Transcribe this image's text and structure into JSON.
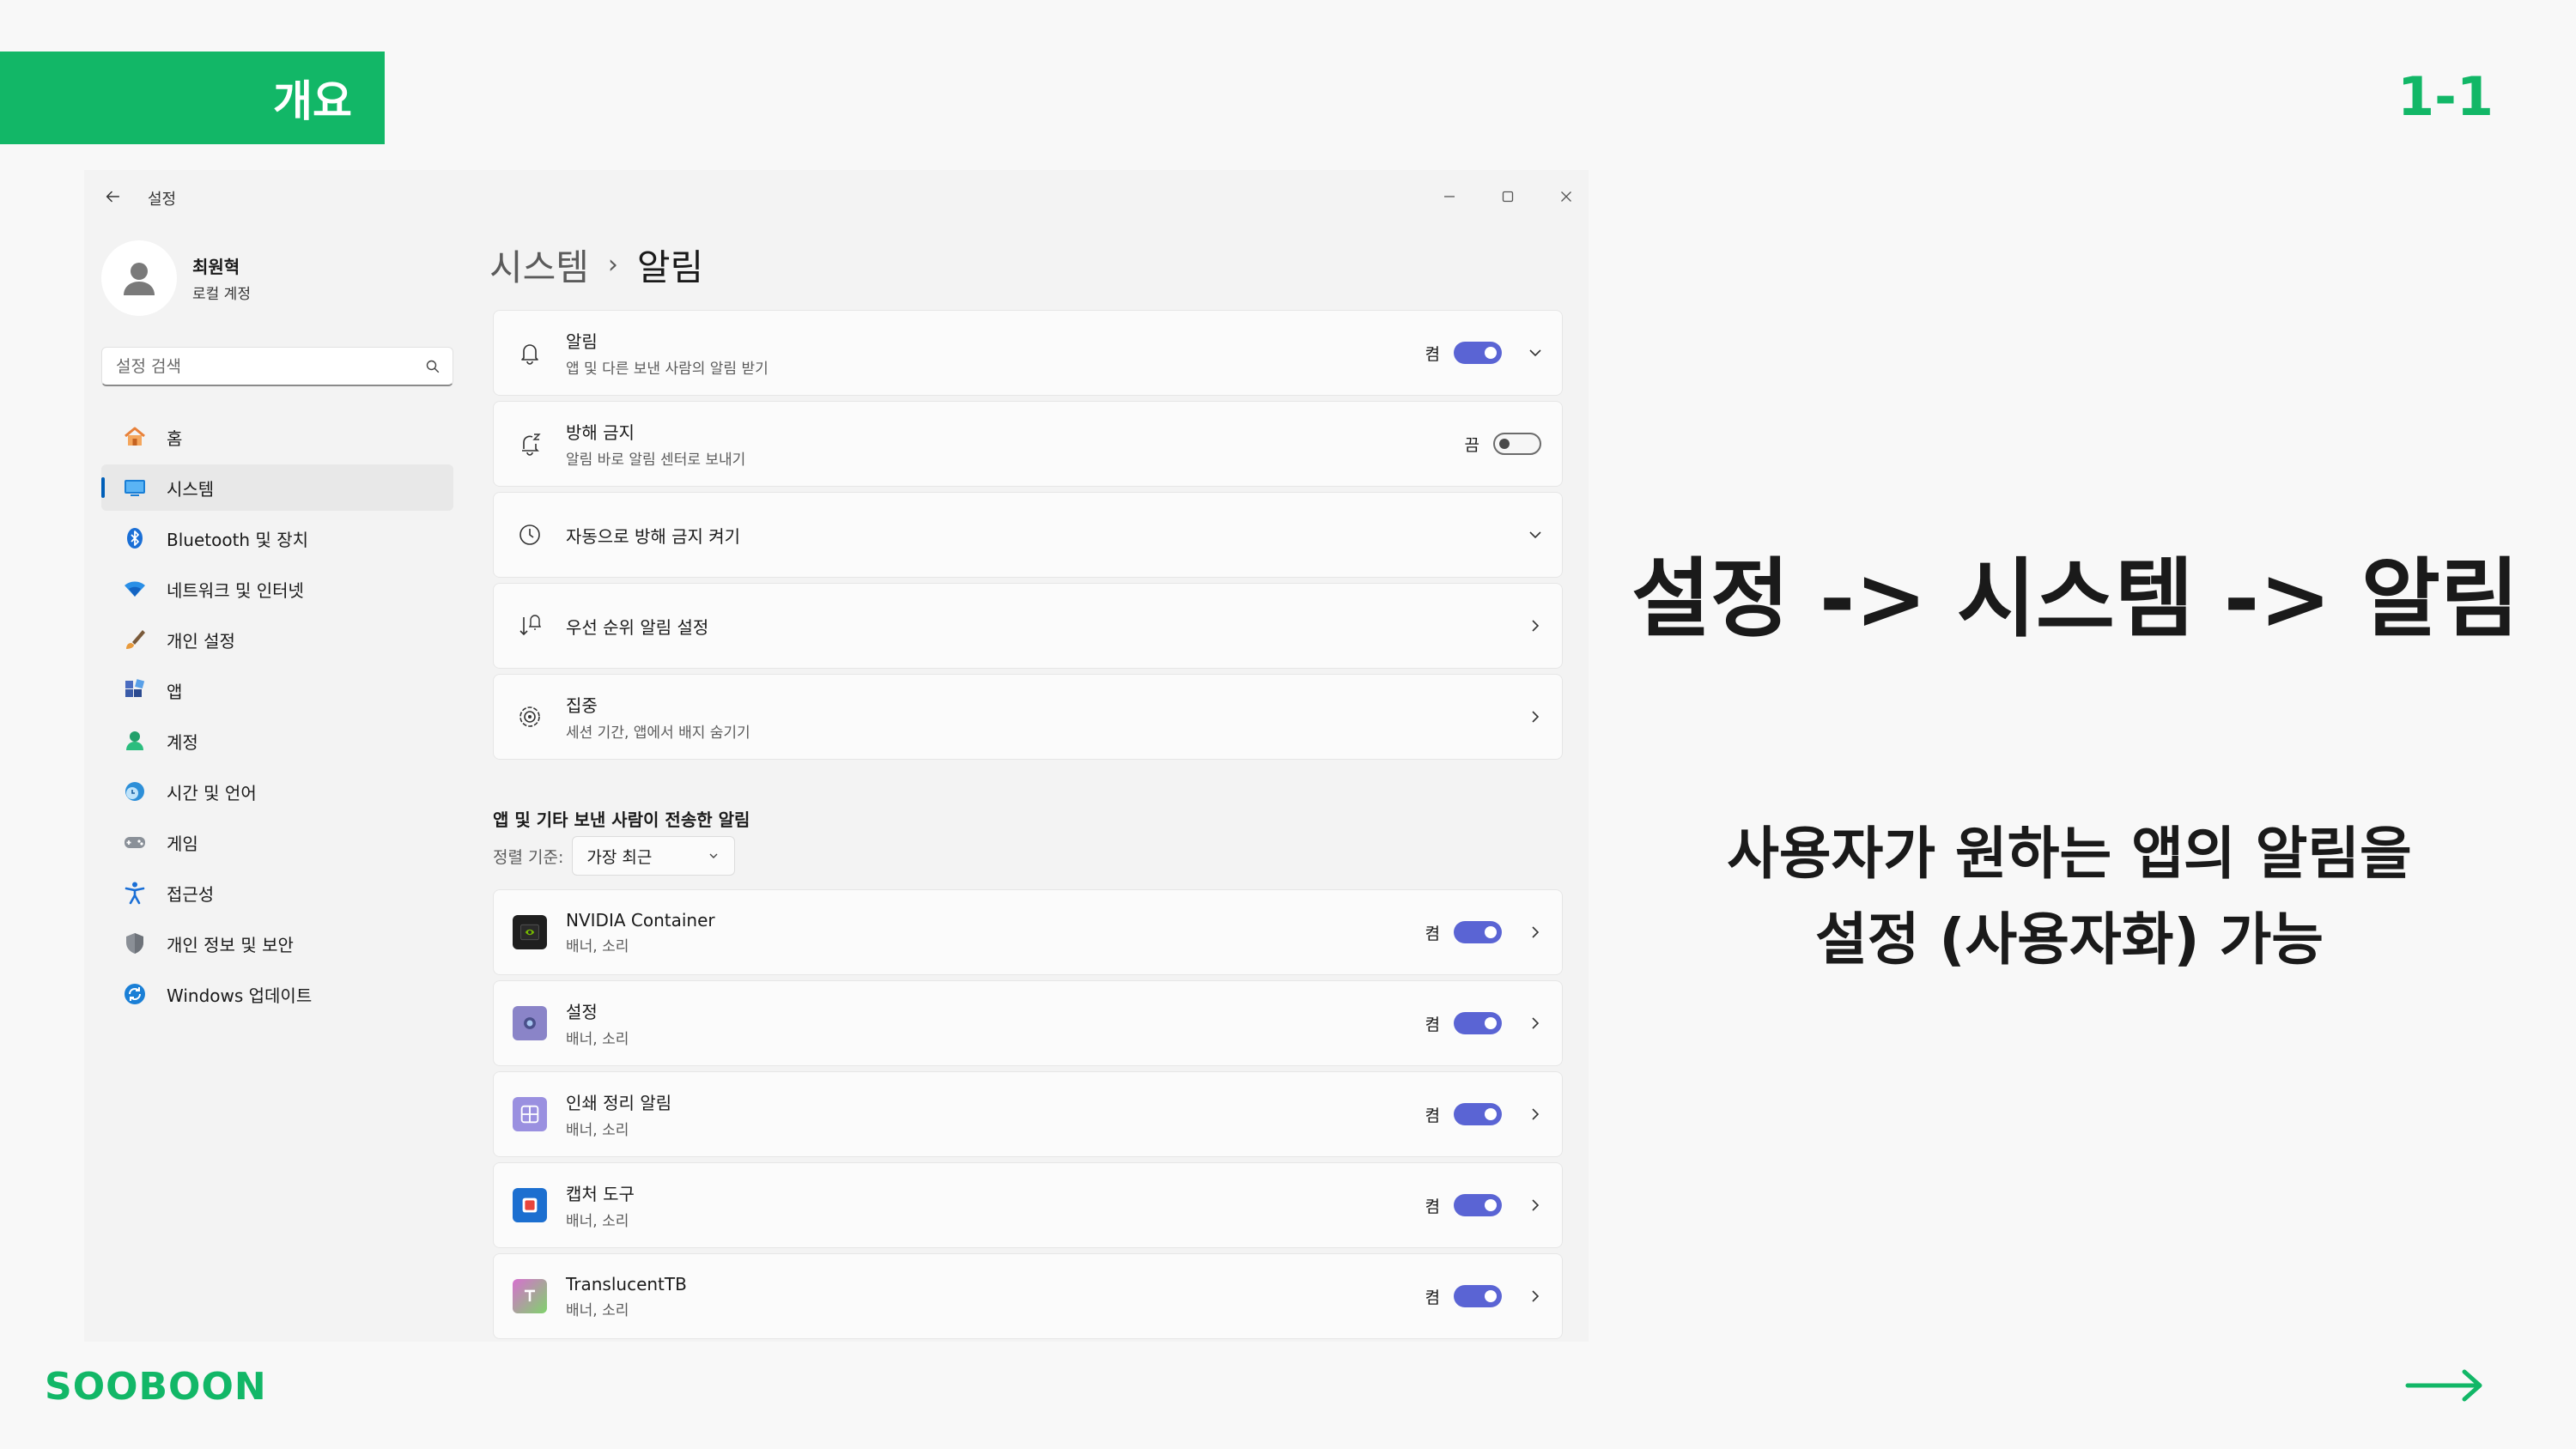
{
  "slide": {
    "section_tag": "개요",
    "page_number": "1-1",
    "headline": "설정 -> 시스템 -> 알림",
    "description_line1": "사용자가 원하는 앱의 알림을",
    "description_line2": "설정 (사용자화) 가능",
    "brand": "SOOBOON",
    "accent_color": "#12b767"
  },
  "window": {
    "title": "설정",
    "controls": [
      "minimize-icon",
      "maximize-icon",
      "close-icon"
    ]
  },
  "profile": {
    "name": "최원혁",
    "account_type": "로컬 계정"
  },
  "search": {
    "placeholder": "설정 검색"
  },
  "sidebar": {
    "items": [
      {
        "label": "홈",
        "icon": "home-icon"
      },
      {
        "label": "시스템",
        "icon": "system-icon",
        "active": true
      },
      {
        "label": "Bluetooth 및 장치",
        "icon": "bluetooth-icon"
      },
      {
        "label": "네트워크 및 인터넷",
        "icon": "wifi-icon"
      },
      {
        "label": "개인 설정",
        "icon": "brush-icon"
      },
      {
        "label": "앱",
        "icon": "apps-icon"
      },
      {
        "label": "계정",
        "icon": "account-icon"
      },
      {
        "label": "시간 및 언어",
        "icon": "globe-clock-icon"
      },
      {
        "label": "게임",
        "icon": "gamepad-icon"
      },
      {
        "label": "접근성",
        "icon": "accessibility-icon"
      },
      {
        "label": "개인 정보 및 보안",
        "icon": "shield-icon"
      },
      {
        "label": "Windows 업데이트",
        "icon": "update-icon"
      }
    ]
  },
  "breadcrumb": {
    "parent": "시스템",
    "separator": "›",
    "current": "알림"
  },
  "settings": [
    {
      "title": "알림",
      "subtitle": "앱 및 다른 보낸 사람의 알림 받기",
      "state": "켬",
      "toggle": true,
      "icon": "bell-icon",
      "trail": "chevron-down-icon"
    },
    {
      "title": "방해 금지",
      "subtitle": "알림 바로 알림 센터로 보내기",
      "state": "끔",
      "toggle": false,
      "icon": "bell-snooze-icon"
    },
    {
      "title": "자동으로 방해 금지 켜기",
      "icon": "clock-icon",
      "trail": "chevron-down-icon"
    },
    {
      "title": "우선 순위 알림 설정",
      "icon": "priority-icon",
      "trail": "chevron-right-icon"
    },
    {
      "title": "집중",
      "subtitle": "세션 기간, 앱에서 배지 숨기기",
      "icon": "focus-icon",
      "trail": "chevron-right-icon"
    }
  ],
  "apps_section": {
    "title": "앱 및 기타 보낸 사람이 전송한 알림",
    "sort_label": "정렬 기준:",
    "sort_value": "가장 최근"
  },
  "apps": [
    {
      "name": "NVIDIA Container",
      "subtitle": "배너, 소리",
      "state": "켬",
      "toggle": true,
      "icon": "nvidia-icon"
    },
    {
      "name": "설정",
      "subtitle": "배너, 소리",
      "state": "켬",
      "toggle": true,
      "icon": "settings-gear-icon"
    },
    {
      "name": "인쇄 정리 알림",
      "subtitle": "배너, 소리",
      "state": "켬",
      "toggle": true,
      "icon": "print-icon"
    },
    {
      "name": "캡처 도구",
      "subtitle": "배너, 소리",
      "state": "켬",
      "toggle": true,
      "icon": "snipping-tool-icon"
    },
    {
      "name": "TranslucentTB",
      "subtitle": "배너, 소리",
      "state": "켬",
      "toggle": true,
      "icon": "translucenttb-icon"
    }
  ]
}
